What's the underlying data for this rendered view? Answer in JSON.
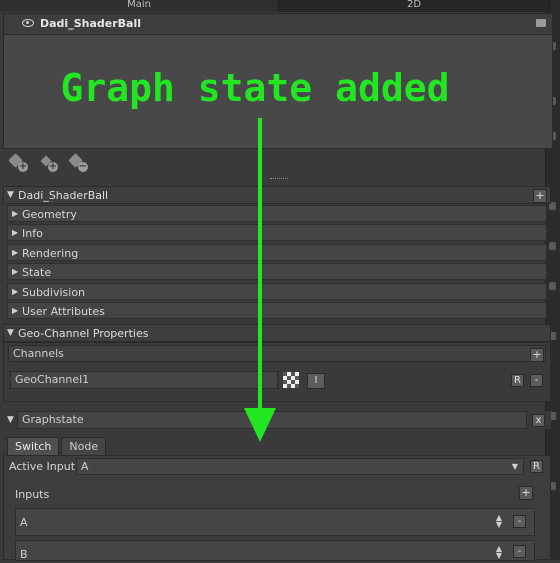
{
  "top_tabs": [
    "Main",
    "2D"
  ],
  "outliner": {
    "item_name": "Dadi_ShaderBall"
  },
  "annotation": {
    "text": "Graph state added",
    "color": "#22e622"
  },
  "attributes": {
    "object_name": "Dadi_ShaderBall",
    "sections": [
      "Geometry",
      "Info",
      "Rendering",
      "State",
      "Subdivision",
      "User Attributes"
    ]
  },
  "geo_channel": {
    "title": "Geo-Channel Properties",
    "channels_label": "Channels",
    "channel_value": "GeoChannel1",
    "i_btn": "I",
    "r_btn": "R",
    "minus": "-"
  },
  "graphstate": {
    "title": "Graphstate",
    "close": "x",
    "tabs": [
      "Switch",
      "Node"
    ],
    "active_input_label": "Active Input",
    "active_input_value": "A",
    "r_btn": "R",
    "inputs_label": "Inputs",
    "inputs": [
      "A",
      "B"
    ],
    "minus": "-"
  }
}
